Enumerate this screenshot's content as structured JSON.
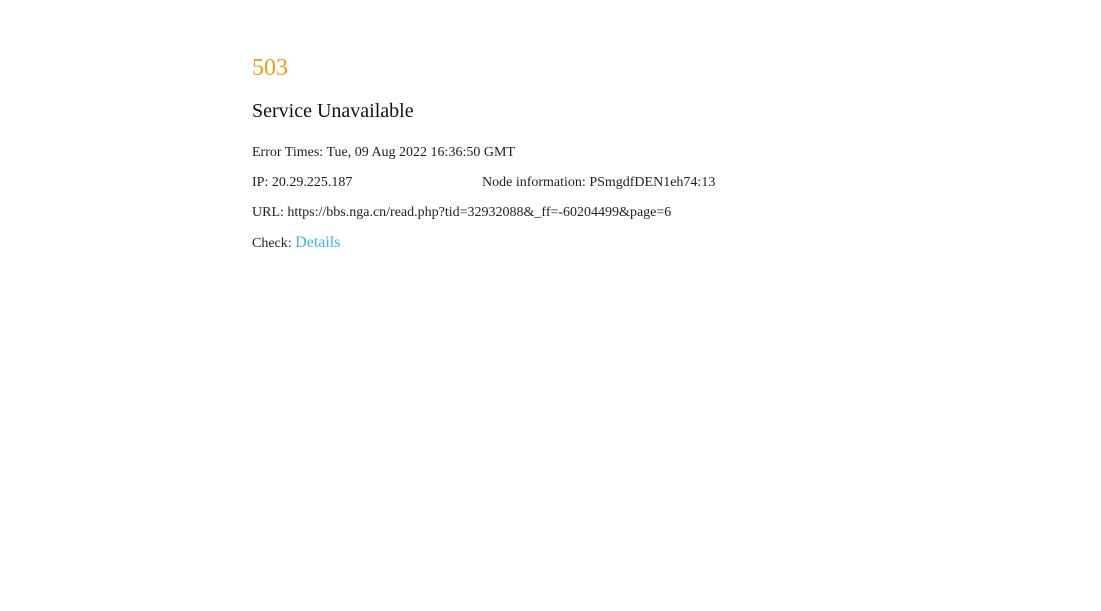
{
  "error": {
    "code": "503",
    "title": "Service Unavailable"
  },
  "info": {
    "error_times_label": "Error Times:",
    "error_times_value": "Tue, 09 Aug 2022 16:36:50 GMT",
    "ip_label": "IP:",
    "ip_value": "20.29.225.187",
    "node_label": "Node information:",
    "node_value": "PSmgdfDEN1eh74:13",
    "url_label": "URL:",
    "url_value": "https://bbs.nga.cn/read.php?tid=32932088&_ff=-60204499&page=6",
    "check_label": "Check:",
    "details_link": "Details"
  },
  "colors": {
    "code": "#f39c12",
    "link": "#3fb8d8",
    "text": "#222222"
  }
}
